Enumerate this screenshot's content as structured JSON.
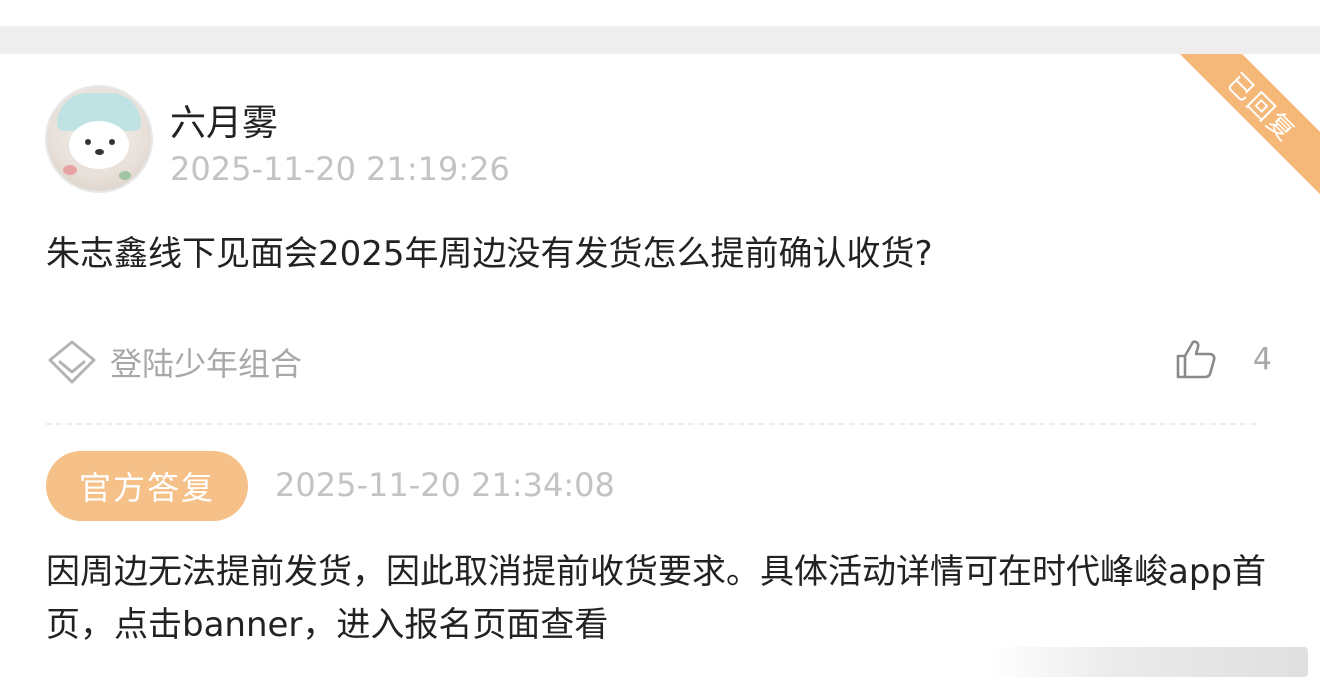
{
  "top_strip": {
    "partial_text": ""
  },
  "ribbon": {
    "label": "已回复"
  },
  "post": {
    "username": "六月雾",
    "time": "2025-11-20 21:19:26",
    "question": "朱志鑫线下见面会2025年周边没有发货怎么提前确认收货?",
    "tag_icon": "diamond-icon",
    "tag_label": "登陆少年组合",
    "like_icon": "thumbs-up-icon",
    "like_count": "4"
  },
  "reply": {
    "badge": "官方答复",
    "time": "2025-11-20 21:34:08",
    "text": "因周边无法提前发货，因此取消提前收货要求。具体活动详情可在时代峰峻app首页，点击banner，进入报名页面查看"
  },
  "colors": {
    "ribbon": "#f6b878",
    "badge": "#f6c089",
    "muted": "#c3c3c3",
    "text": "#222222"
  }
}
